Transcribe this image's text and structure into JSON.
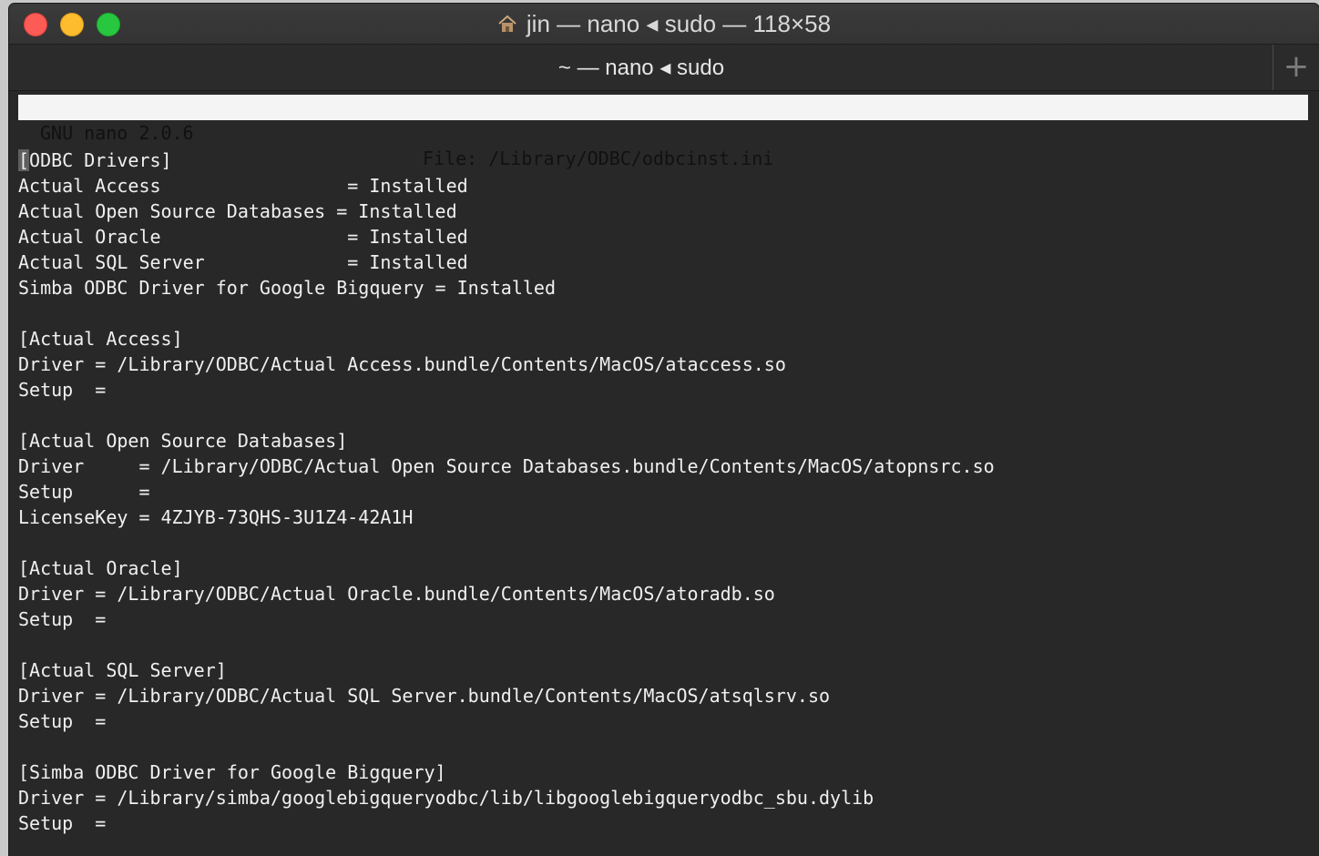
{
  "window": {
    "title": "jin — nano ◂ sudo — 118×58",
    "tab_title": "~ — nano ◂ sudo",
    "new_tab_label": "+"
  },
  "nano": {
    "version": "GNU nano 2.0.6",
    "file": "File: /Library/ODBC/odbcinst.ini"
  },
  "content": {
    "lines": [
      "[ODBC Drivers]",
      "Actual Access                 = Installed",
      "Actual Open Source Databases = Installed",
      "Actual Oracle                 = Installed",
      "Actual SQL Server             = Installed",
      "Simba ODBC Driver for Google Bigquery = Installed",
      "",
      "[Actual Access]",
      "Driver = /Library/ODBC/Actual Access.bundle/Contents/MacOS/ataccess.so",
      "Setup  =",
      "",
      "[Actual Open Source Databases]",
      "Driver     = /Library/ODBC/Actual Open Source Databases.bundle/Contents/MacOS/atopnsrc.so",
      "Setup      =",
      "LicenseKey = 4ZJYB-73QHS-3U1Z4-42A1H",
      "",
      "[Actual Oracle]",
      "Driver = /Library/ODBC/Actual Oracle.bundle/Contents/MacOS/atoradb.so",
      "Setup  =",
      "",
      "[Actual SQL Server]",
      "Driver = /Library/ODBC/Actual SQL Server.bundle/Contents/MacOS/atsqlsrv.so",
      "Setup  =",
      "",
      "[Simba ODBC Driver for Google Bigquery]",
      "Driver = /Library/simba/googlebigqueryodbc/lib/libgooglebigqueryodbc_sbu.dylib",
      "Setup  ="
    ]
  },
  "colors": {
    "background": "#282828",
    "text": "#f0f0f0",
    "header_bg": "#f4f4f4",
    "close": "#fd5c56",
    "minimize": "#fdbb2e",
    "maximize": "#27c83f"
  }
}
